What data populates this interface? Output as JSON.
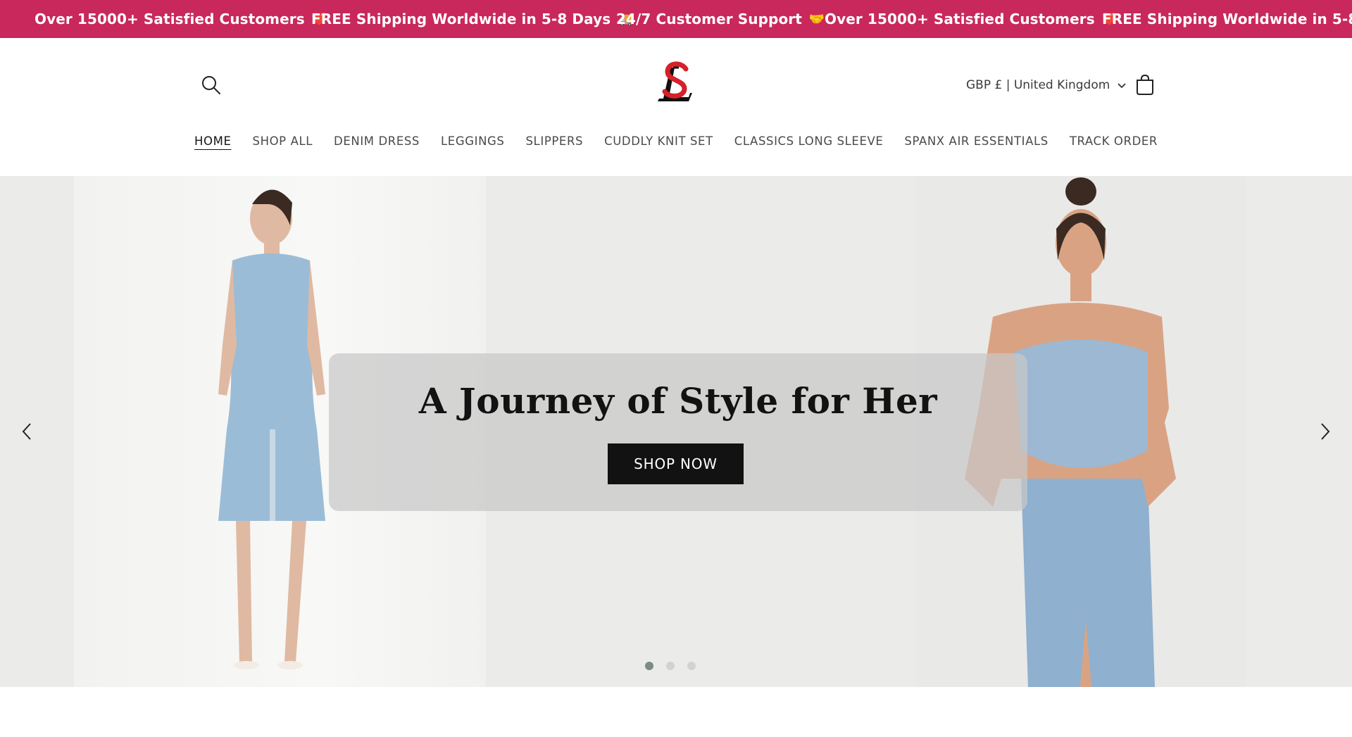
{
  "announcement": {
    "items": [
      {
        "text": "Over 15000+ Satisfied Customers",
        "emoji": "❤️"
      },
      {
        "text": "FREE Shipping Worldwide in 5-8 Days",
        "emoji": "🚚"
      },
      {
        "text": "24/7 Customer Support",
        "emoji": "🤝"
      },
      {
        "text": "Over 15000+ Satisfied Customers",
        "emoji": "❤️"
      },
      {
        "text": "FREE Shipping Worldwide in 5-8 Days",
        "emoji": "🚚"
      }
    ],
    "bg_color": "#c9285c"
  },
  "header": {
    "locale": "GBP £ | United Kingdom",
    "logo_colors": {
      "s": "#d6202a",
      "l": "#111111"
    }
  },
  "nav": {
    "items": [
      "HOME",
      "SHOP ALL",
      "DENIM DRESS",
      "LEGGINGS",
      "SLIPPERS",
      "CUDDLY KNIT SET",
      "CLASSICS LONG SLEEVE",
      "SPANX AIR ESSENTIALS",
      "TRACK ORDER"
    ],
    "active": "HOME"
  },
  "hero": {
    "title": "A Journey of Style for Her",
    "button": "SHOP NOW",
    "slides": 3,
    "active_slide": 1
  }
}
